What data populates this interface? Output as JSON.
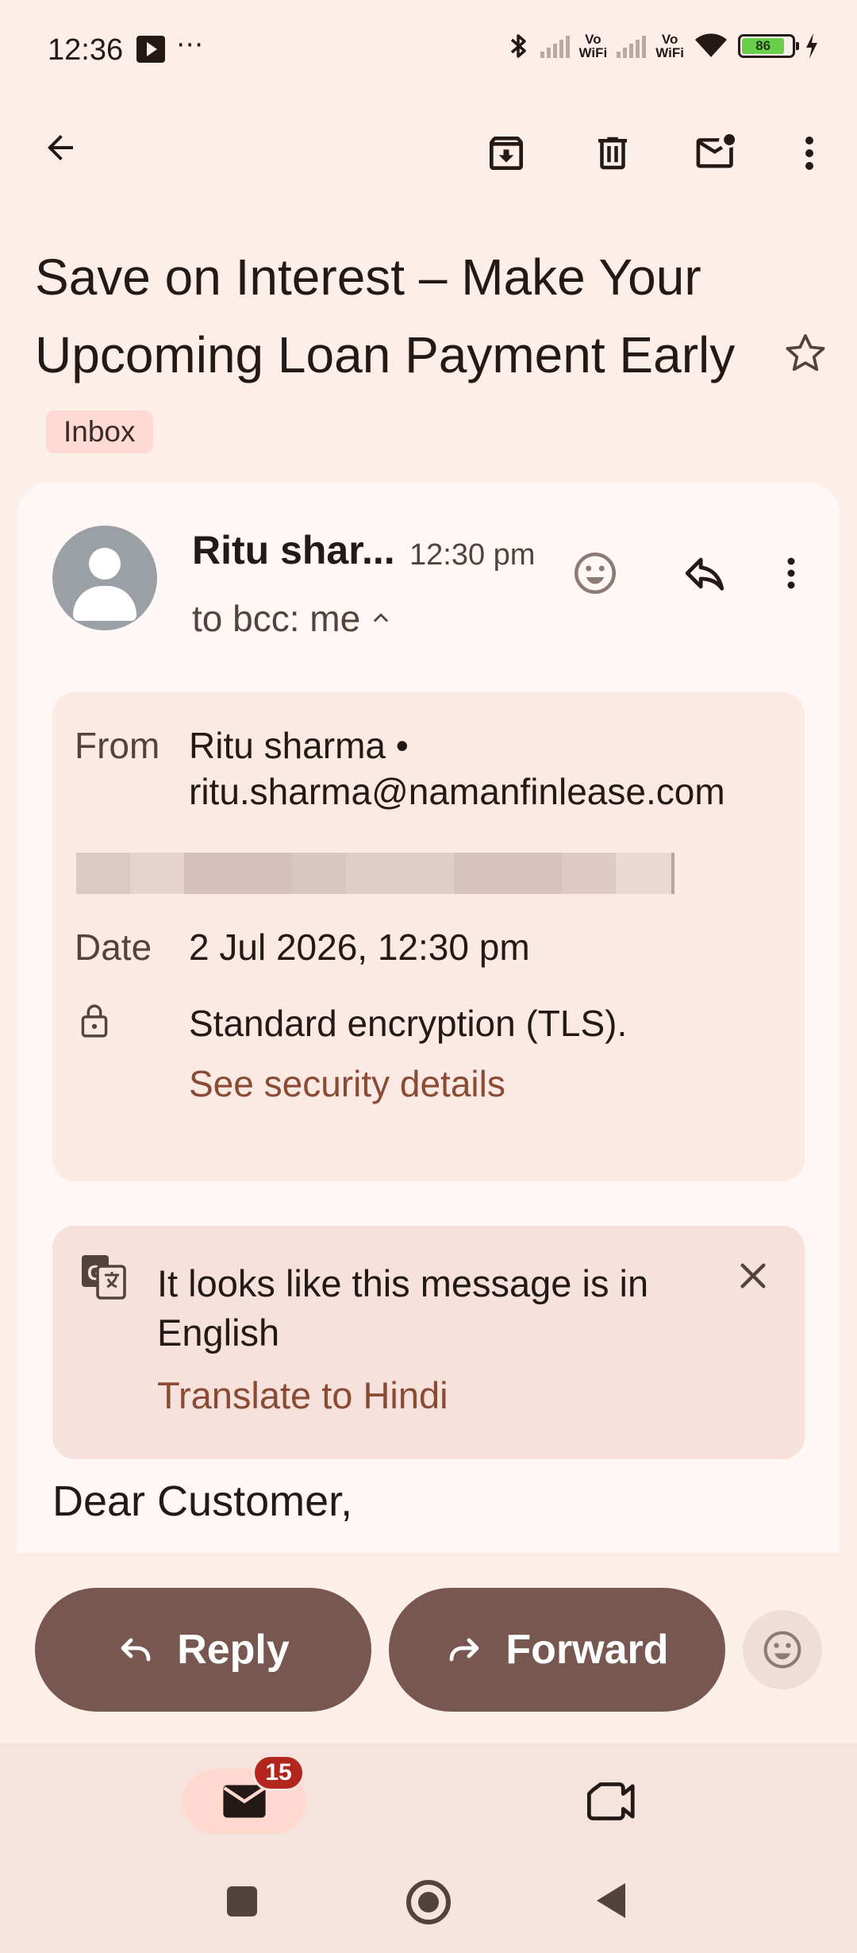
{
  "status_bar": {
    "time": "12:36",
    "more": "⋯",
    "vo_label_1": "Vo",
    "wifi_label_1": "WiFi",
    "vo_label_2": "Vo",
    "wifi_label_2": "WiFi",
    "battery_level": "86",
    "icons": [
      "media-icon",
      "bluetooth-icon",
      "signal-icon",
      "wifi-icon",
      "battery-icon",
      "charging-icon"
    ]
  },
  "toolbar": {
    "icons": [
      "back-arrow-icon",
      "archive-icon",
      "delete-icon",
      "mark-unread-icon",
      "more-vert-icon"
    ]
  },
  "email": {
    "subject": "Save on Interest – Make Your Upcoming Loan Payment Early",
    "label_chip": "Inbox",
    "starred": false
  },
  "header": {
    "sender_short": "Ritu shar...",
    "time": "12:30 pm",
    "recipient": "to bcc: me"
  },
  "details": {
    "from_label": "From",
    "from_name": "Ritu sharma •",
    "from_email": "ritu.sharma@namanfinlease.com",
    "date_label": "Date",
    "date_value": "2 Jul 2026, 12:30 pm",
    "encryption": "Standard encryption (TLS).",
    "security_link": "See security details"
  },
  "translate": {
    "message": "It looks like this message is in English",
    "action": "Translate to Hindi"
  },
  "body": {
    "greeting": "Dear Customer,"
  },
  "actions": {
    "reply": "Reply",
    "forward": "Forward"
  },
  "bottom_nav": {
    "mail_badge": "15",
    "items": [
      "mail-icon",
      "video-icon"
    ]
  },
  "colors": {
    "background": "#fcefe9",
    "card": "#fff7f5",
    "primary_button": "#775750",
    "link": "#8a4a33",
    "badge": "#b3261e"
  }
}
